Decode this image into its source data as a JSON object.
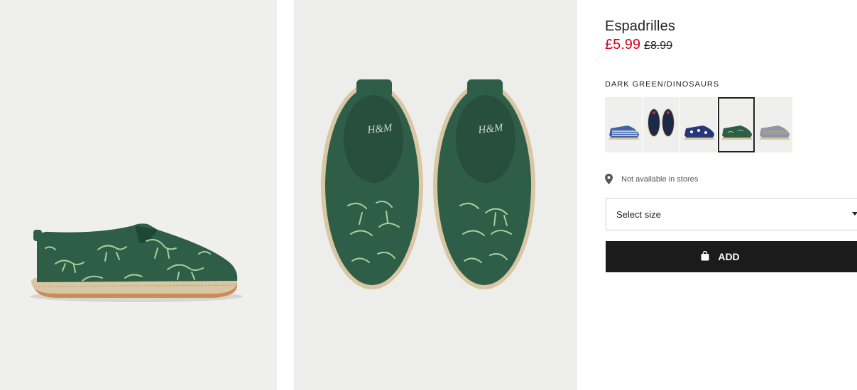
{
  "product": {
    "title": "Espadrilles",
    "price_sale": "£5.99",
    "price_old": "£8.99"
  },
  "colors": {
    "price_sale": "#d6001c",
    "shoe_green": "#2e5d48",
    "dino_print": "#a9cf98",
    "jute_sole": "#d9c6a2",
    "button_bg": "#1b1b1b"
  },
  "gallery": {
    "images": [
      {
        "name": "product-image-side",
        "alt": "side view"
      },
      {
        "name": "product-image-top",
        "alt": "top view"
      }
    ]
  },
  "color_selector": {
    "label": "DARK GREEN/DINOSAURS",
    "selected_index": 3,
    "swatches": [
      {
        "name": "blue-white-stripes"
      },
      {
        "name": "dark-navy"
      },
      {
        "name": "navy-dinosaurs"
      },
      {
        "name": "dark-green-dinosaurs"
      },
      {
        "name": "grey-stripes"
      }
    ]
  },
  "availability": {
    "icon": "location-pin-icon",
    "text": "Not available in stores"
  },
  "size": {
    "placeholder": "Select size",
    "icon": "caret-down-icon"
  },
  "add_button": {
    "label": "ADD",
    "icon": "shopping-bag-icon"
  }
}
